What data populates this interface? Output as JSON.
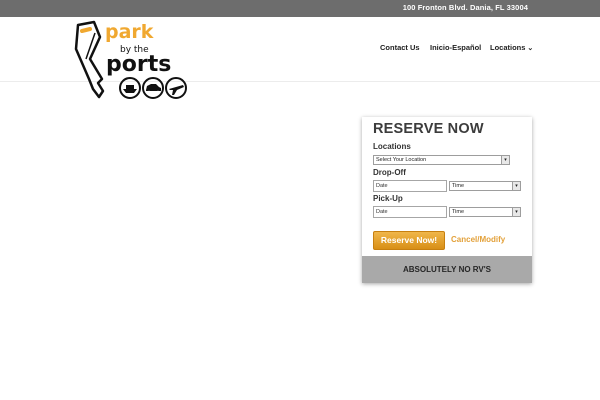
{
  "topbar": {
    "address": "100 Fronton Blvd. Dania, FL 33004"
  },
  "logo": {
    "line1": "park",
    "line2": "by the",
    "line3": "ports",
    "icons": [
      "ship-icon",
      "car-icon",
      "plane-icon"
    ]
  },
  "nav": {
    "contact": "Contact Us",
    "inicio": "Inicio-Español",
    "locations": "Locations"
  },
  "reserve": {
    "title": "RESERVE NOW",
    "locations_label": "Locations",
    "location_select": "Select Your Location",
    "dropoff_label": "Drop-Off",
    "pickup_label": "Pick-Up",
    "date_placeholder": "Date",
    "time_placeholder": "Time",
    "button": "Reserve Now!",
    "cancel": "Cancel/Modify",
    "banner": "ABSOLUTELY NO RV'S"
  },
  "colors": {
    "accent": "#f0a830",
    "topbar": "#6d6d6d",
    "banner": "#a9a9a9"
  }
}
